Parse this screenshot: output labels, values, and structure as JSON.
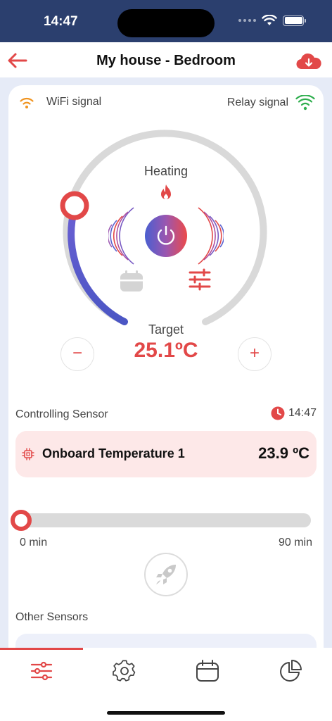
{
  "status_bar": {
    "time": "14:47"
  },
  "header": {
    "title": "My house - Bedroom"
  },
  "signals": {
    "wifi_label": "WiFi signal",
    "relay_label": "Relay signal",
    "wifi_color": "#f0931e",
    "relay_color": "#2fae4e"
  },
  "thermostat": {
    "mode": "Heating",
    "target_label": "Target",
    "target_value": "25.1ºC",
    "minus_label": "−",
    "plus_label": "+",
    "accent_color": "#e24848"
  },
  "controlling_sensor": {
    "label": "Controlling Sensor",
    "time": "14:47",
    "sensor_name": "Onboard Temperature 1",
    "sensor_value": "23.9 ºC"
  },
  "boost": {
    "min_label": "0 min",
    "max_label": "90 min",
    "level": 0
  },
  "other_sensors": {
    "label": "Other Sensors"
  },
  "tabs": [
    {
      "icon": "sliders-icon",
      "active": true
    },
    {
      "icon": "gear-icon",
      "active": false
    },
    {
      "icon": "calendar-icon",
      "active": false
    },
    {
      "icon": "pie-chart-icon",
      "active": false
    }
  ]
}
